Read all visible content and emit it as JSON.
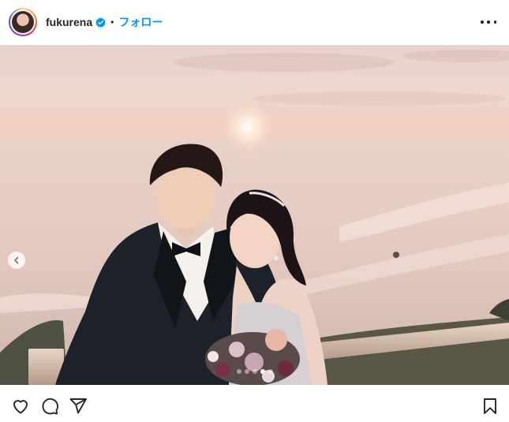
{
  "post": {
    "username": "fukurena",
    "separator": "•",
    "follow_label": "フォロー",
    "verified_color": "#0095f6",
    "carousel": {
      "current_slide": 4,
      "total_slides": 5
    }
  },
  "icons": {
    "more": "more-horizontal-icon",
    "prev": "chevron-left-icon",
    "like": "heart-icon",
    "comment": "comment-icon",
    "share": "share-icon",
    "save": "bookmark-icon"
  },
  "colors": {
    "link": "#0095f6",
    "text": "#262626"
  }
}
